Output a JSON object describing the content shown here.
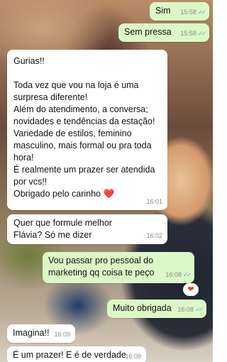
{
  "messages": [
    {
      "text": "Sim",
      "time": "15:58",
      "ticks": "✓✓"
    },
    {
      "text": "Sem pressa",
      "time": "15:58",
      "ticks": "✓✓"
    },
    {
      "text": "Gurias!!\n\nToda vez que vou na loja é uma surpresa diferente!\nAlém do atendimento, a conversa; novidades  e tendências da estação!\nVariedade de estilos, feminino masculino, mais formal ou pra toda hora!\nÉ realmente um prazer ser atendida por vcs!!\nObrigado pelo carinho ❤️",
      "time": "16:01"
    },
    {
      "text": "Quer que formule melhor Flávia? Só me dizer",
      "time": "16:02"
    },
    {
      "text": "Vou passar pro pessoal do marketing qq coisa te peço",
      "time": "16:08",
      "ticks": "✓✓",
      "reaction": "❤"
    },
    {
      "text": "Muito obrigada",
      "time": "16:08",
      "ticks": "✓✓"
    },
    {
      "text": "Imagina!!",
      "time": "16:09"
    },
    {
      "text": "É um prazer! E é de verdade",
      "time": "16:09"
    }
  ]
}
